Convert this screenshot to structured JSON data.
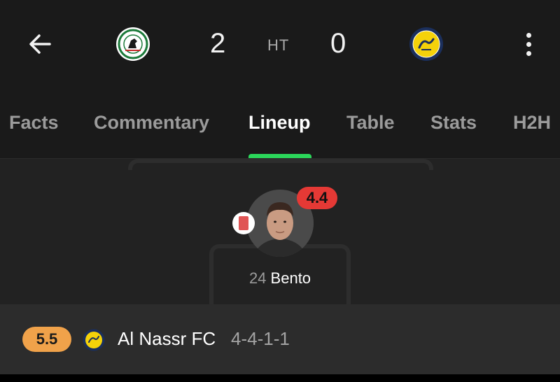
{
  "header": {
    "home_team_crest": "al-ittihad-club-crest",
    "away_team_crest": "al-nassr-crest",
    "home_score": "2",
    "away_score": "0",
    "status": "HT"
  },
  "tabs": [
    {
      "label": "Facts"
    },
    {
      "label": "Commentary"
    },
    {
      "label": "Lineup",
      "active": true
    },
    {
      "label": "Table"
    },
    {
      "label": "Stats"
    },
    {
      "label": "H2H"
    }
  ],
  "player": {
    "number": "24",
    "name": "Bento",
    "rating": "4.4",
    "card": "red-card-icon",
    "rating_color": "#e53935"
  },
  "team_bar": {
    "rating": "5.5",
    "rating_color": "#f0a24a",
    "team_name": "Al Nassr FC",
    "formation": "4-4-1-1"
  },
  "colors": {
    "accent": "#2bd75a",
    "background": "#1a1a1a"
  }
}
